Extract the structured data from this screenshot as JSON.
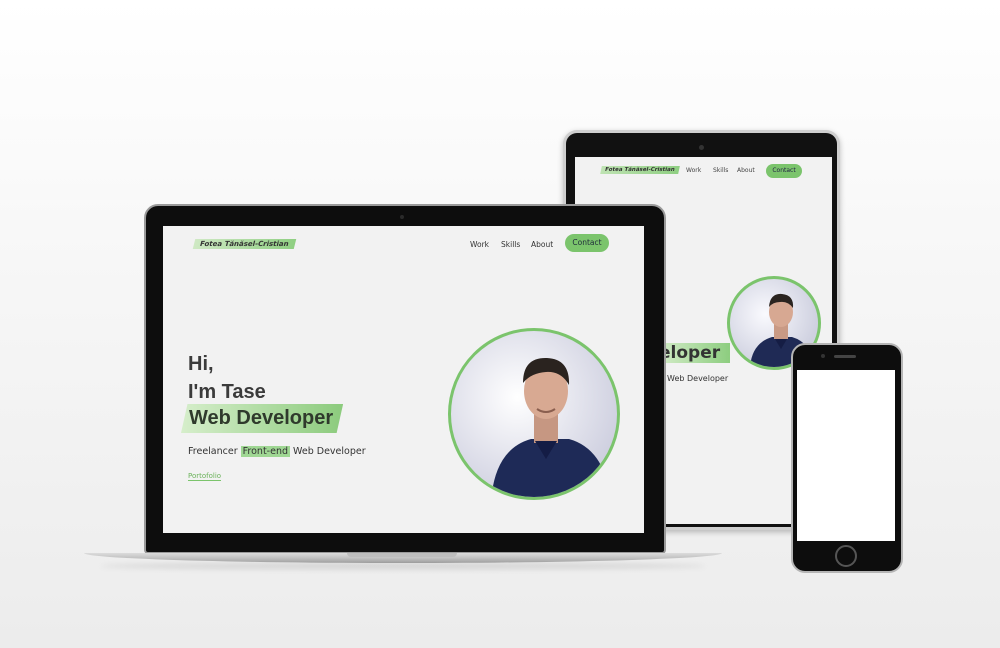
{
  "site": {
    "logo": "Fotea Tănăsel-Cristian",
    "nav": [
      "Work",
      "Skills",
      "About"
    ],
    "contact_label": "Contact",
    "greeting_line1": "Hi,",
    "greeting_line2": "I'm Tase",
    "headline": "Web Developer",
    "subtitle_prefix": "Freelancer ",
    "subtitle_highlight": "Front-end",
    "subtitle_suffix": " Web Developer",
    "portfolio_label": "Portofolio"
  },
  "tablet": {
    "headline_visible": "eloper",
    "subtitle_visible": "Web Developer"
  },
  "colors": {
    "accent": "#7bc46c",
    "text": "#333333",
    "background": "#f2f2f2"
  },
  "icons": [
    "avatar-photo"
  ]
}
